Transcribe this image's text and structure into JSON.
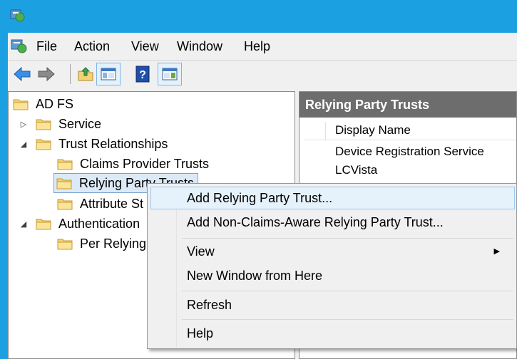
{
  "menubar": {
    "items": [
      "File",
      "Action",
      "View",
      "Window",
      "Help"
    ]
  },
  "toolbar": {
    "buttons": [
      "back-icon",
      "forward-icon",
      "up-folder-icon",
      "show-hide-console-tree-icon",
      "help-icon",
      "show-hide-action-pane-icon"
    ]
  },
  "tree": {
    "root": "AD FS",
    "service": "Service",
    "trust_relationships": "Trust Relationships",
    "claims_provider_trusts": "Claims Provider Trusts",
    "relying_party_trusts": "Relying Party Trusts",
    "attribute_stores": "Attribute St",
    "authentication": "Authentication",
    "per_relying": "Per Relying"
  },
  "right_pane": {
    "header": "Relying Party Trusts",
    "column_header": "Display Name",
    "rows": [
      "Device Registration Service",
      "LCVista"
    ]
  },
  "context_menu": {
    "items": [
      "Add Relying Party Trust...",
      "Add Non-Claims-Aware Relying Party Trust...",
      "View",
      "New Window from Here",
      "Refresh",
      "Help"
    ]
  },
  "colors": {
    "title_bar": "#1ba1e2",
    "header_bg": "#6d6d6d",
    "hover_bg": "#e5f1fb",
    "folder": "#f3d274"
  }
}
